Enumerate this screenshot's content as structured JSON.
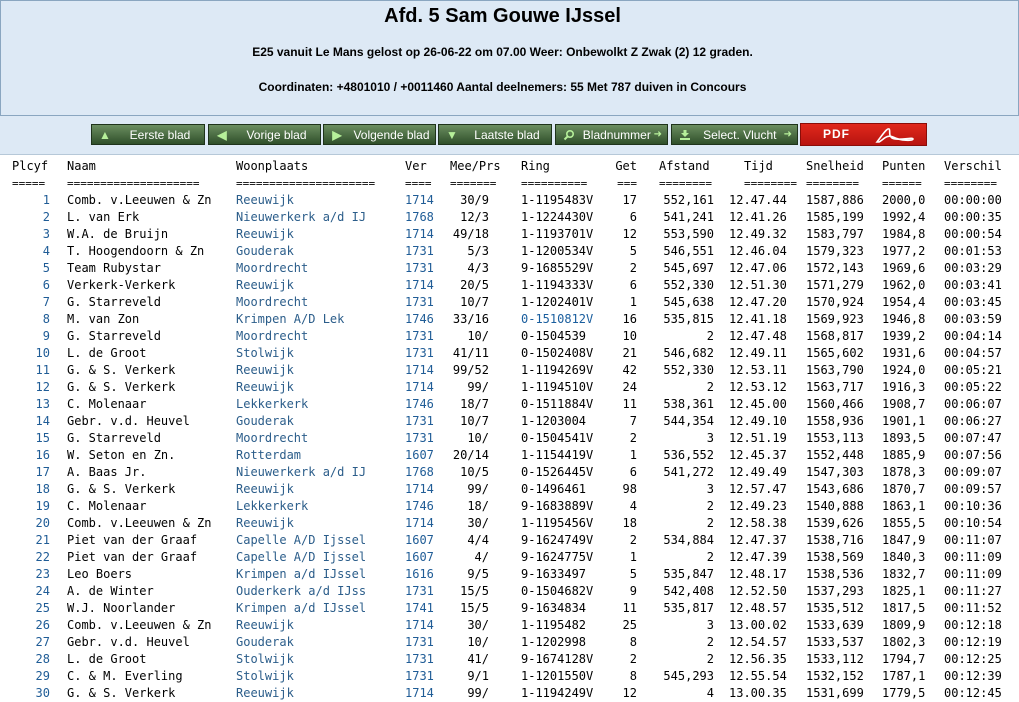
{
  "header": {
    "title": "Afd. 5 Sam Gouwe IJssel",
    "line1": "E25 vanuit Le Mans gelost op 26-06-22 om 07.00 Weer: Onbewolkt Z Zwak (2) 12 graden.",
    "line2": "Coordinaten: +4801010 / +0011460 Aantal deelnemers: 55 Met 787 duiven in Concours"
  },
  "nav": {
    "first": "Eerste blad",
    "prev": "Vorige blad",
    "next": "Volgende blad",
    "last": "Laatste blad",
    "page_number": "Bladnummer",
    "select_flight": "Select. Vlucht",
    "pdf": "PDF"
  },
  "table": {
    "headers": {
      "plcyf": "Plcyf",
      "naam": "Naam",
      "woonplaats": "Woonplaats",
      "ver": "Ver",
      "meeprs": "Mee/Prs",
      "ring": "Ring",
      "get": "Get",
      "afstand": "Afstand",
      "tijd": "Tijd",
      "snelheid": "Snelheid",
      "punten": "Punten",
      "verschil": "Verschil"
    },
    "separators": {
      "plcyf": "=====",
      "naam": "====================",
      "woonplaats": "=====================",
      "ver": "====",
      "meeprs": "=======",
      "ring": "==========",
      "get": "===",
      "afstand": "========",
      "tijd": "========",
      "snelheid": "========",
      "punten": "======",
      "verschil": "========"
    },
    "rows": [
      {
        "plc": "1",
        "naam": "Comb. v.Leeuwen & Zn",
        "woon": "Reeuwijk",
        "ver": "1714",
        "mee": "30/9",
        "ring": "1-1195483V",
        "get": "17",
        "afs": "552,161",
        "tijd": "12.47.44",
        "snel": "1587,886",
        "pnt": "2000,0",
        "vers": "00:00:00"
      },
      {
        "plc": "2",
        "naam": "L. van Erk",
        "woon": "Nieuwerkerk a/d IJ",
        "ver": "1768",
        "mee": "12/3",
        "ring": "1-1224430V",
        "get": "6",
        "afs": "541,241",
        "tijd": "12.41.26",
        "snel": "1585,199",
        "pnt": "1992,4",
        "vers": "00:00:35"
      },
      {
        "plc": "3",
        "naam": "W.A. de Bruijn",
        "woon": "Reeuwijk",
        "ver": "1714",
        "mee": "49/18",
        "ring": "1-1193701V",
        "get": "12",
        "afs": "553,590",
        "tijd": "12.49.32",
        "snel": "1583,797",
        "pnt": "1984,8",
        "vers": "00:00:54"
      },
      {
        "plc": "4",
        "naam": "T. Hoogendoorn & Zn",
        "woon": "Gouderak",
        "ver": "1731",
        "mee": "5/3",
        "ring": "1-1200534V",
        "get": "5",
        "afs": "546,551",
        "tijd": "12.46.04",
        "snel": "1579,323",
        "pnt": "1977,2",
        "vers": "00:01:53"
      },
      {
        "plc": "5",
        "naam": "Team Rubystar",
        "woon": "Moordrecht",
        "ver": "1731",
        "mee": "4/3",
        "ring": "9-1685529V",
        "get": "2",
        "afs": "545,697",
        "tijd": "12.47.06",
        "snel": "1572,143",
        "pnt": "1969,6",
        "vers": "00:03:29"
      },
      {
        "plc": "6",
        "naam": "Verkerk-Verkerk",
        "woon": "Reeuwijk",
        "ver": "1714",
        "mee": "20/5",
        "ring": "1-1194333V",
        "get": "6",
        "afs": "552,330",
        "tijd": "12.51.30",
        "snel": "1571,279",
        "pnt": "1962,0",
        "vers": "00:03:41"
      },
      {
        "plc": "7",
        "naam": "G. Starreveld",
        "woon": "Moordrecht",
        "ver": "1731",
        "mee": "10/7",
        "ring": "1-1202401V",
        "get": "1",
        "afs": "545,638",
        "tijd": "12.47.20",
        "snel": "1570,924",
        "pnt": "1954,4",
        "vers": "00:03:45"
      },
      {
        "plc": "8",
        "naam": "M. van Zon",
        "woon": "Krimpen A/D Lek",
        "ver": "1746",
        "mee": "33/16",
        "ring": "0-1510812V",
        "get": "16",
        "afs": "535,815",
        "tijd": "12.41.18",
        "snel": "1569,923",
        "pnt": "1946,8",
        "vers": "00:03:59",
        "ringblue": true
      },
      {
        "plc": "9",
        "naam": "G. Starreveld",
        "woon": "Moordrecht",
        "ver": "1731",
        "mee": "10/",
        "ring": "0-1504539",
        "get": "10",
        "afs": "2",
        "tijd": "12.47.48",
        "snel": "1568,817",
        "pnt": "1939,2",
        "vers": "00:04:14"
      },
      {
        "plc": "10",
        "naam": "L. de Groot",
        "woon": "Stolwijk",
        "ver": "1731",
        "mee": "41/11",
        "ring": "0-1502408V",
        "get": "21",
        "afs": "546,682",
        "tijd": "12.49.11",
        "snel": "1565,602",
        "pnt": "1931,6",
        "vers": "00:04:57"
      },
      {
        "plc": "11",
        "naam": "G. & S. Verkerk",
        "woon": "Reeuwijk",
        "ver": "1714",
        "mee": "99/52",
        "ring": "1-1194269V",
        "get": "42",
        "afs": "552,330",
        "tijd": "12.53.11",
        "snel": "1563,790",
        "pnt": "1924,0",
        "vers": "00:05:21"
      },
      {
        "plc": "12",
        "naam": "G. & S. Verkerk",
        "woon": "Reeuwijk",
        "ver": "1714",
        "mee": "99/",
        "ring": "1-1194510V",
        "get": "24",
        "afs": "2",
        "tijd": "12.53.12",
        "snel": "1563,717",
        "pnt": "1916,3",
        "vers": "00:05:22"
      },
      {
        "plc": "13",
        "naam": "C. Molenaar",
        "woon": "Lekkerkerk",
        "ver": "1746",
        "mee": "18/7",
        "ring": "0-1511884V",
        "get": "11",
        "afs": "538,361",
        "tijd": "12.45.00",
        "snel": "1560,466",
        "pnt": "1908,7",
        "vers": "00:06:07"
      },
      {
        "plc": "14",
        "naam": "Gebr. v.d. Heuvel",
        "woon": "Gouderak",
        "ver": "1731",
        "mee": "10/7",
        "ring": "1-1203004",
        "get": "7",
        "afs": "544,354",
        "tijd": "12.49.10",
        "snel": "1558,936",
        "pnt": "1901,1",
        "vers": "00:06:27"
      },
      {
        "plc": "15",
        "naam": "G. Starreveld",
        "woon": "Moordrecht",
        "ver": "1731",
        "mee": "10/",
        "ring": "0-1504541V",
        "get": "2",
        "afs": "3",
        "tijd": "12.51.19",
        "snel": "1553,113",
        "pnt": "1893,5",
        "vers": "00:07:47"
      },
      {
        "plc": "16",
        "naam": "W. Seton en Zn.",
        "woon": "Rotterdam",
        "ver": "1607",
        "mee": "20/14",
        "ring": "1-1154419V",
        "get": "1",
        "afs": "536,552",
        "tijd": "12.45.37",
        "snel": "1552,448",
        "pnt": "1885,9",
        "vers": "00:07:56"
      },
      {
        "plc": "17",
        "naam": "A. Baas Jr.",
        "woon": "Nieuwerkerk a/d IJ",
        "ver": "1768",
        "mee": "10/5",
        "ring": "0-1526445V",
        "get": "6",
        "afs": "541,272",
        "tijd": "12.49.49",
        "snel": "1547,303",
        "pnt": "1878,3",
        "vers": "00:09:07"
      },
      {
        "plc": "18",
        "naam": "G. & S. Verkerk",
        "woon": "Reeuwijk",
        "ver": "1714",
        "mee": "99/",
        "ring": "0-1496461",
        "get": "98",
        "afs": "3",
        "tijd": "12.57.47",
        "snel": "1543,686",
        "pnt": "1870,7",
        "vers": "00:09:57"
      },
      {
        "plc": "19",
        "naam": "C. Molenaar",
        "woon": "Lekkerkerk",
        "ver": "1746",
        "mee": "18/",
        "ring": "9-1683889V",
        "get": "4",
        "afs": "2",
        "tijd": "12.49.23",
        "snel": "1540,888",
        "pnt": "1863,1",
        "vers": "00:10:36"
      },
      {
        "plc": "20",
        "naam": "Comb. v.Leeuwen & Zn",
        "woon": "Reeuwijk",
        "ver": "1714",
        "mee": "30/",
        "ring": "1-1195456V",
        "get": "18",
        "afs": "2",
        "tijd": "12.58.38",
        "snel": "1539,626",
        "pnt": "1855,5",
        "vers": "00:10:54"
      },
      {
        "plc": "21",
        "naam": "Piet van der Graaf",
        "woon": "Capelle A/D Ijssel",
        "ver": "1607",
        "mee": "4/4",
        "ring": "9-1624749V",
        "get": "2",
        "afs": "534,884",
        "tijd": "12.47.37",
        "snel": "1538,716",
        "pnt": "1847,9",
        "vers": "00:11:07"
      },
      {
        "plc": "22",
        "naam": "Piet van der Graaf",
        "woon": "Capelle A/D Ijssel",
        "ver": "1607",
        "mee": "4/",
        "ring": "9-1624775V",
        "get": "1",
        "afs": "2",
        "tijd": "12.47.39",
        "snel": "1538,569",
        "pnt": "1840,3",
        "vers": "00:11:09"
      },
      {
        "plc": "23",
        "naam": "Leo Boers",
        "woon": "Krimpen a/d IJssel",
        "ver": "1616",
        "mee": "9/5",
        "ring": "9-1633497",
        "get": "5",
        "afs": "535,847",
        "tijd": "12.48.17",
        "snel": "1538,536",
        "pnt": "1832,7",
        "vers": "00:11:09"
      },
      {
        "plc": "24",
        "naam": "A. de Winter",
        "woon": "Ouderkerk a/d IJss",
        "ver": "1731",
        "mee": "15/5",
        "ring": "0-1504682V",
        "get": "9",
        "afs": "542,408",
        "tijd": "12.52.50",
        "snel": "1537,293",
        "pnt": "1825,1",
        "vers": "00:11:27"
      },
      {
        "plc": "25",
        "naam": "W.J. Noorlander",
        "woon": "Krimpen a/d IJssel",
        "ver": "1741",
        "mee": "15/5",
        "ring": "9-1634834",
        "get": "11",
        "afs": "535,817",
        "tijd": "12.48.57",
        "snel": "1535,512",
        "pnt": "1817,5",
        "vers": "00:11:52"
      },
      {
        "plc": "26",
        "naam": "Comb. v.Leeuwen & Zn",
        "woon": "Reeuwijk",
        "ver": "1714",
        "mee": "30/",
        "ring": "1-1195482",
        "get": "25",
        "afs": "3",
        "tijd": "13.00.02",
        "snel": "1533,639",
        "pnt": "1809,9",
        "vers": "00:12:18"
      },
      {
        "plc": "27",
        "naam": "Gebr. v.d. Heuvel",
        "woon": "Gouderak",
        "ver": "1731",
        "mee": "10/",
        "ring": "1-1202998",
        "get": "8",
        "afs": "2",
        "tijd": "12.54.57",
        "snel": "1533,537",
        "pnt": "1802,3",
        "vers": "00:12:19"
      },
      {
        "plc": "28",
        "naam": "L. de Groot",
        "woon": "Stolwijk",
        "ver": "1731",
        "mee": "41/",
        "ring": "9-1674128V",
        "get": "2",
        "afs": "2",
        "tijd": "12.56.35",
        "snel": "1533,112",
        "pnt": "1794,7",
        "vers": "00:12:25"
      },
      {
        "plc": "29",
        "naam": "C. & M. Everling",
        "woon": "Stolwijk",
        "ver": "1731",
        "mee": "9/1",
        "ring": "1-1201550V",
        "get": "8",
        "afs": "545,293",
        "tijd": "12.55.54",
        "snel": "1532,152",
        "pnt": "1787,1",
        "vers": "00:12:39"
      },
      {
        "plc": "30",
        "naam": "G. & S. Verkerk",
        "woon": "Reeuwijk",
        "ver": "1714",
        "mee": "99/",
        "ring": "1-1194249V",
        "get": "12",
        "afs": "4",
        "tijd": "13.00.35",
        "snel": "1531,699",
        "pnt": "1779,5",
        "vers": "00:12:45"
      }
    ]
  },
  "colors": {
    "header_bg": "#dde9f5",
    "link_blue": "#1f5c96",
    "button_green": "#3f6a36",
    "pdf_red": "#d21f17"
  }
}
